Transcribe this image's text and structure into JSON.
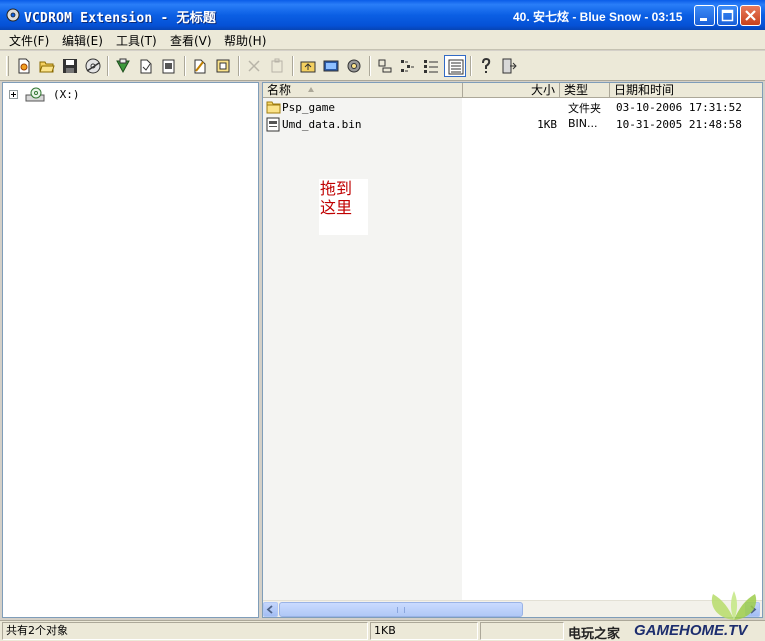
{
  "window": {
    "title": "VCDROM Extension - 无标题",
    "now_playing": "40. 安七炫 - Blue Snow - 03:15"
  },
  "menu": [
    {
      "label": "文件(F)"
    },
    {
      "label": "编辑(E)"
    },
    {
      "label": "工具(T)"
    },
    {
      "label": "查看(V)"
    },
    {
      "label": "帮助(H)"
    }
  ],
  "toolbar": {
    "buttons": [
      {
        "icon": "new-document-icon"
      },
      {
        "icon": "open-folder-icon"
      },
      {
        "icon": "save-icon"
      },
      {
        "icon": "burn-disc-icon"
      },
      {
        "icon": "add-files-icon"
      },
      {
        "icon": "add-folder-icon"
      },
      {
        "icon": "extract-icon"
      },
      {
        "icon": "rename-icon"
      },
      {
        "icon": "properties-icon"
      },
      {
        "icon": "delete-icon",
        "disabled": true
      },
      {
        "icon": "paste-icon",
        "disabled": true
      },
      {
        "icon": "up-folder-icon"
      },
      {
        "icon": "image-info-icon"
      },
      {
        "icon": "settings-icon"
      },
      {
        "icon": "large-icons-view-icon"
      },
      {
        "icon": "small-icons-view-icon"
      },
      {
        "icon": "list-view-icon"
      },
      {
        "icon": "details-view-icon",
        "active": true
      },
      {
        "icon": "help-icon"
      },
      {
        "icon": "exit-icon"
      }
    ]
  },
  "tree": {
    "root_label": "(X:)"
  },
  "list": {
    "columns": {
      "name": "名称",
      "size": "大小",
      "type": "类型",
      "modified": "日期和时间"
    },
    "rows": [
      {
        "icon": "folder-icon",
        "name": "Psp_game",
        "size": "",
        "type": "文件夹",
        "modified": "03-10-2006 17:31:52"
      },
      {
        "icon": "file-icon",
        "name": "Umd_data.bin",
        "size": "1KB",
        "type": "BIN...",
        "modified": "10-31-2005 21:48:58"
      }
    ],
    "drag_hint_line1": "拖到",
    "drag_hint_line2": "这里"
  },
  "status": {
    "object_count": "共有2个对象",
    "selection_size": "1KB"
  },
  "watermark": {
    "cn": "电玩之家",
    "en": "GAMEHOME.TV"
  },
  "colors": {
    "titlebar": "#0b5fe4",
    "drag_hint_text": "#c00000",
    "watermark_text": "#1d2e6e"
  }
}
